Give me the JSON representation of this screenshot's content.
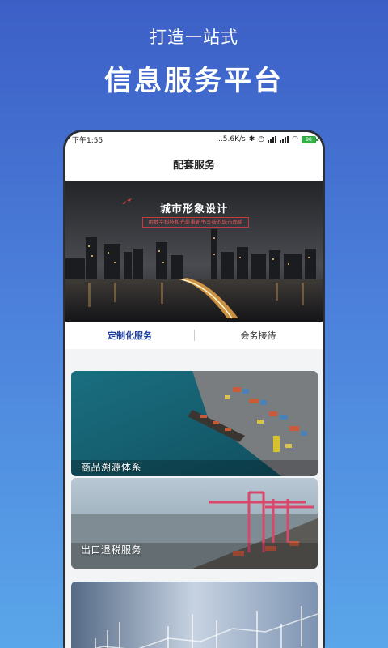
{
  "promo": {
    "subtitle": "打造一站式",
    "title": "信息服务平台"
  },
  "status": {
    "time": "下午1:55",
    "speed": "...5.6K/s",
    "battery": "98"
  },
  "header": {
    "title": "配套服务"
  },
  "banner": {
    "title": "城市形象设计",
    "subtitle": "用数字科技和光影重新书写新的城市面貌"
  },
  "tabs": [
    {
      "label": "定制化服务"
    },
    {
      "label": "会务接待"
    }
  ],
  "cards": [
    {
      "label": "商品溯源体系"
    },
    {
      "label": "出口退税服务"
    },
    {
      "label": ""
    }
  ],
  "colors": {
    "accent": "#1e3f9e",
    "background_top": "#3c5fc6",
    "background_bottom": "#5aa6ea"
  }
}
